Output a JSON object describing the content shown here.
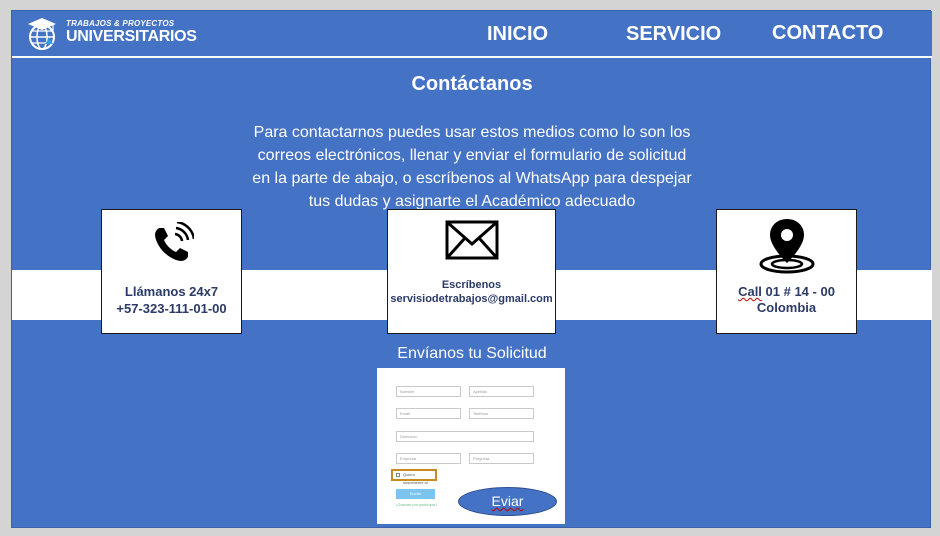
{
  "header": {
    "logo_small": "TRABAJOS & PROYECTOS",
    "logo_big": "UNIVERSITARIOS",
    "nav": [
      "INICIO",
      "SERVICIO",
      "CONTACTO"
    ]
  },
  "contact": {
    "title": "Contáctanos",
    "description": "Para contactarnos puedes usar estos medios como lo son los correos electrónicos, llenar y enviar el formulario de solicitud en la parte de abajo, o escríbenos al WhatsApp para despejar tus dudas y asignarte el Académico adecuado"
  },
  "cards": [
    {
      "icon": "phone-icon",
      "line1": "Llámanos 24x7",
      "line2": "+57-323-111-01-00"
    },
    {
      "icon": "envelope-icon",
      "line1": "Escríbenos",
      "line2": "servisiodetrabajos@gmail.com"
    },
    {
      "icon": "location-pin-icon",
      "line1_word": "Call",
      "line1_rest": " 01 # 14 - 00",
      "line2": "Colombia"
    }
  ],
  "form": {
    "title": "Envíanos tu Solicitud",
    "fields": [
      "Nombre",
      "Apellido",
      "Email",
      "Teléfono",
      "Dirección",
      "Empresa",
      "Pregunta"
    ],
    "checkbox_label": "Quiero suscribirme al boletín",
    "send_label": "Enviar",
    "small_note": "¡Gracias por participar!",
    "submit_label": "Eviar"
  },
  "colors": {
    "page_bg": "#4472c4",
    "card_text": "#2b3a67",
    "white": "#ffffff"
  }
}
